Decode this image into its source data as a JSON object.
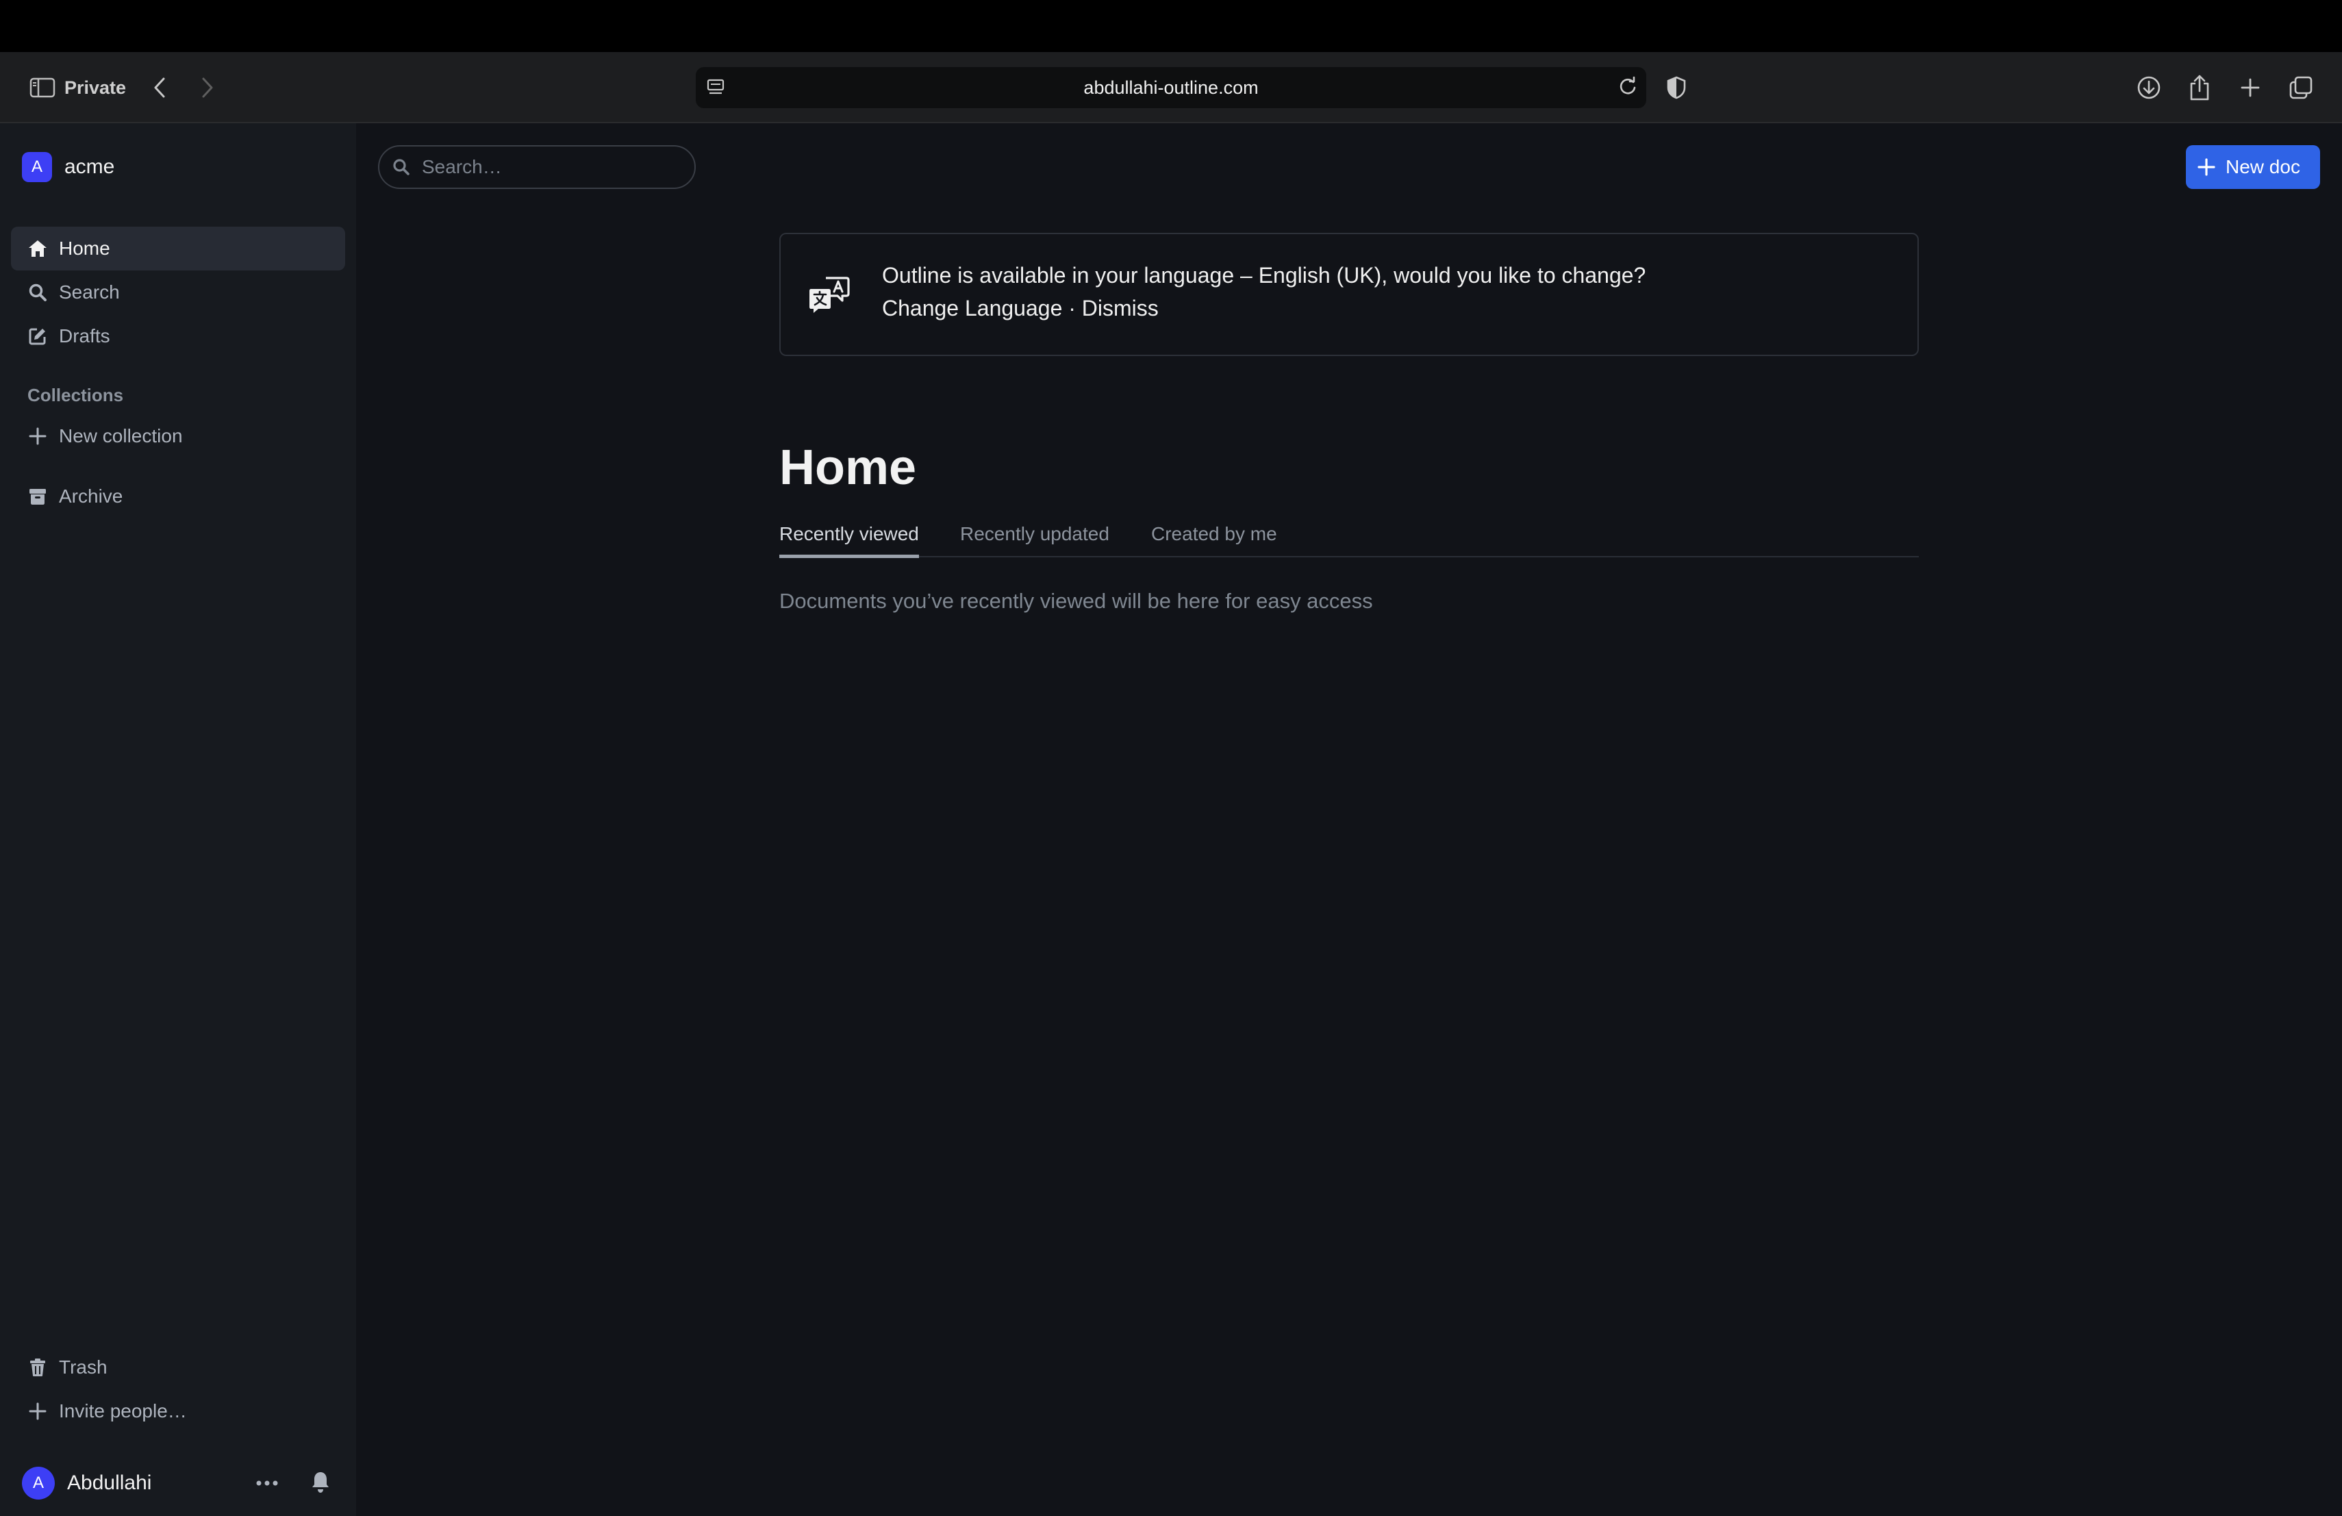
{
  "browser": {
    "private_label": "Private",
    "url": "abdullahi-outline.com"
  },
  "sidebar": {
    "team_initial": "A",
    "team_name": "acme",
    "nav": [
      {
        "label": "Home",
        "icon": "home-icon"
      },
      {
        "label": "Search",
        "icon": "search-icon"
      },
      {
        "label": "Drafts",
        "icon": "edit-icon"
      }
    ],
    "collections_label": "Collections",
    "new_collection_label": "New collection",
    "archive_label": "Archive",
    "trash_label": "Trash",
    "invite_label": "Invite people…",
    "user_initial": "A",
    "user_name": "Abdullahi"
  },
  "header": {
    "search_placeholder": "Search…",
    "new_doc_label": "New doc"
  },
  "notice": {
    "message": "Outline is available in your language – English (UK), would you like to change?",
    "change_label": "Change Language",
    "separator": " · ",
    "dismiss_label": "Dismiss"
  },
  "main": {
    "title": "Home",
    "tabs": [
      {
        "label": "Recently viewed",
        "active": true
      },
      {
        "label": "Recently updated",
        "active": false
      },
      {
        "label": "Created by me",
        "active": false
      }
    ],
    "empty_message": "Documents you’ve recently viewed will be here for easy access"
  },
  "colors": {
    "accent": "#2f63e6",
    "avatar": "#3d3ff5",
    "sidebar_bg": "#171a1f",
    "main_bg": "#111318"
  }
}
